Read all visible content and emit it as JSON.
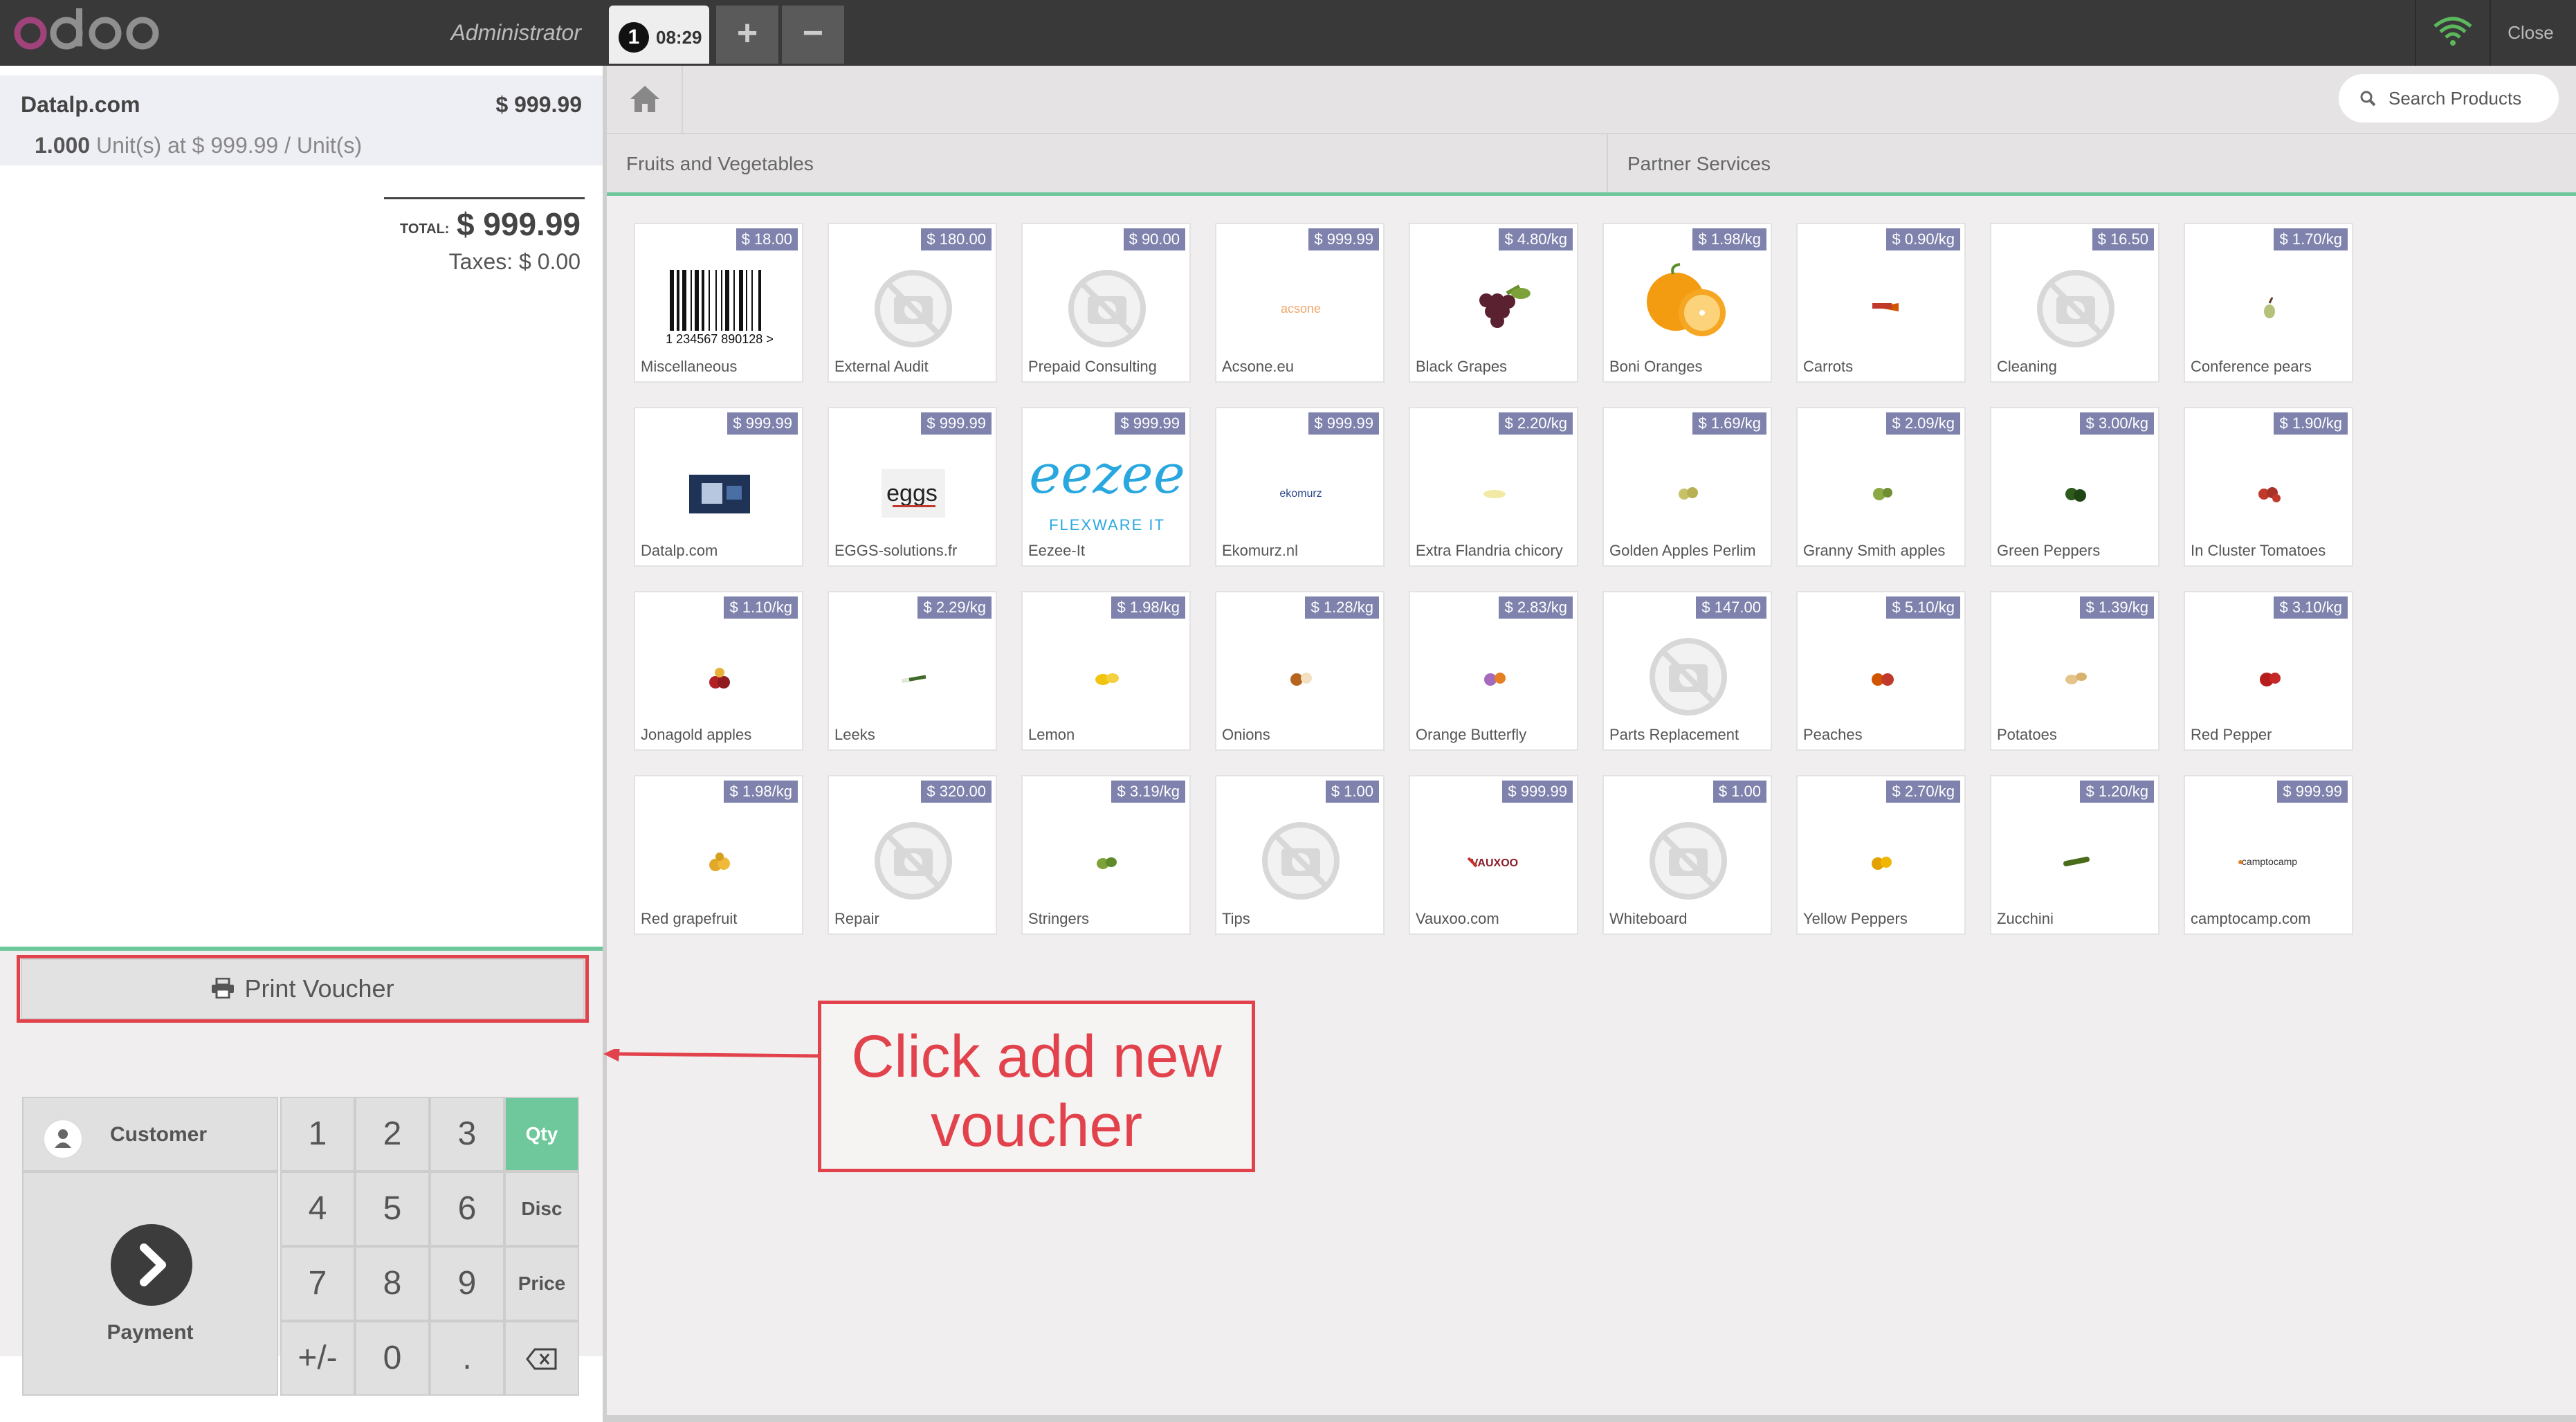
{
  "header": {
    "logo_text": "odoo",
    "cashier": "Administrator",
    "order": {
      "number": "1",
      "time": "08:29"
    },
    "add_order_label": "+",
    "remove_order_label": "−",
    "close_label": "Close",
    "icons": {
      "wifi": "wifi-icon",
      "home": "home-icon",
      "search": "search-icon"
    }
  },
  "order": {
    "lines": [
      {
        "name": "Datalp.com",
        "price": "$ 999.99",
        "qty": "1.000",
        "unit_text": "Unit(s) at $ 999.99 / Unit(s)"
      }
    ],
    "total_label": "TOTAL:",
    "total_value": "$ 999.99",
    "taxes_label": "Taxes:",
    "taxes_value": "$ 0.00"
  },
  "actions": {
    "voucher_label": "Print Voucher",
    "customer_label": "Customer",
    "payment_label": "Payment"
  },
  "numpad": {
    "keys": [
      "1",
      "2",
      "3",
      "4",
      "5",
      "6",
      "7",
      "8",
      "9",
      "+/-",
      "0",
      "."
    ],
    "modes": [
      "Qty",
      "Disc",
      "Price"
    ],
    "active_mode": "Qty",
    "backspace_icon": "backspace-icon"
  },
  "search": {
    "placeholder": "Search Products"
  },
  "categories": [
    "Fruits and Vegetables",
    "Partner Services"
  ],
  "products": [
    {
      "name": "Miscellaneous",
      "price": "$ 18.00",
      "img": "barcode"
    },
    {
      "name": "External Audit",
      "price": "$ 180.00",
      "img": "placeholder"
    },
    {
      "name": "Prepaid Consulting",
      "price": "$ 90.00",
      "img": "placeholder"
    },
    {
      "name": "Acsone.eu",
      "price": "$ 999.99",
      "img": "logo-acsone"
    },
    {
      "name": "Black Grapes",
      "price": "$ 4.80/kg",
      "img": "grapes"
    },
    {
      "name": "Boni Oranges",
      "price": "$ 1.98/kg",
      "img": "oranges"
    },
    {
      "name": "Carrots",
      "price": "$ 0.90/kg",
      "img": "carrot"
    },
    {
      "name": "Cleaning",
      "price": "$ 16.50",
      "img": "placeholder"
    },
    {
      "name": "Conference pears",
      "price": "$ 1.70/kg",
      "img": "pear"
    },
    {
      "name": "Datalp.com",
      "price": "$ 999.99",
      "img": "logo-datalp"
    },
    {
      "name": "EGGS-solutions.fr",
      "price": "$ 999.99",
      "img": "logo-eggs"
    },
    {
      "name": "Eezee-It",
      "price": "$ 999.99",
      "img": "logo-eezee"
    },
    {
      "name": "Ekomurz.nl",
      "price": "$ 999.99",
      "img": "logo-ekomurz"
    },
    {
      "name": "Extra Flandria chicory",
      "price": "$ 2.20/kg",
      "img": "chicory"
    },
    {
      "name": "Golden Apples Perlim",
      "price": "$ 1.69/kg",
      "img": "golden-apples"
    },
    {
      "name": "Granny Smith apples",
      "price": "$ 2.09/kg",
      "img": "green-apples"
    },
    {
      "name": "Green Peppers",
      "price": "$ 3.00/kg",
      "img": "green-peppers"
    },
    {
      "name": "In Cluster Tomatoes",
      "price": "$ 1.90/kg",
      "img": "tomatoes"
    },
    {
      "name": "Jonagold apples",
      "price": "$ 1.10/kg",
      "img": "red-apples"
    },
    {
      "name": "Leeks",
      "price": "$ 2.29/kg",
      "img": "leek"
    },
    {
      "name": "Lemon",
      "price": "$ 1.98/kg",
      "img": "lemon"
    },
    {
      "name": "Onions",
      "price": "$ 1.28/kg",
      "img": "onion"
    },
    {
      "name": "Orange Butterfly",
      "price": "$ 2.83/kg",
      "img": "orange-fruit"
    },
    {
      "name": "Parts Replacement",
      "price": "$ 147.00",
      "img": "placeholder"
    },
    {
      "name": "Peaches",
      "price": "$ 5.10/kg",
      "img": "peach"
    },
    {
      "name": "Potatoes",
      "price": "$ 1.39/kg",
      "img": "potato"
    },
    {
      "name": "Red Pepper",
      "price": "$ 3.10/kg",
      "img": "red-pepper"
    },
    {
      "name": "Red grapefruit",
      "price": "$ 1.98/kg",
      "img": "grapefruit"
    },
    {
      "name": "Repair",
      "price": "$ 320.00",
      "img": "placeholder"
    },
    {
      "name": "Stringers",
      "price": "$ 3.19/kg",
      "img": "beans"
    },
    {
      "name": "Tips",
      "price": "$ 1.00",
      "img": "placeholder"
    },
    {
      "name": "Vauxoo.com",
      "price": "$ 999.99",
      "img": "logo-vauxoo"
    },
    {
      "name": "Whiteboard",
      "price": "$ 1.00",
      "img": "placeholder"
    },
    {
      "name": "Yellow Peppers",
      "price": "$ 2.70/kg",
      "img": "yellow-pepper"
    },
    {
      "name": "Zucchini",
      "price": "$ 1.20/kg",
      "img": "zucchini"
    },
    {
      "name": "camptocamp.com",
      "price": "$ 999.99",
      "img": "logo-camptocamp"
    }
  ],
  "product_image_text": {
    "barcode": "1 234567 890128 >",
    "logo-acsone": "acsone",
    "logo-eggs": "eggs",
    "logo-eezee": "eezee",
    "logo-eezee-sub": "FLEXWARE IT",
    "logo-ekomurz": "ekomurz",
    "logo-vauxoo": "VAUXOO",
    "logo-camptocamp": "camptocamp"
  },
  "annotation": {
    "line1": "Click add new",
    "line2": "voucher",
    "color": "#e2424c"
  },
  "colors": {
    "header": "#393939",
    "accent_green": "#6ec89b",
    "price_tag": "#7f82ac",
    "order_line_bg": "#eeeef5"
  }
}
